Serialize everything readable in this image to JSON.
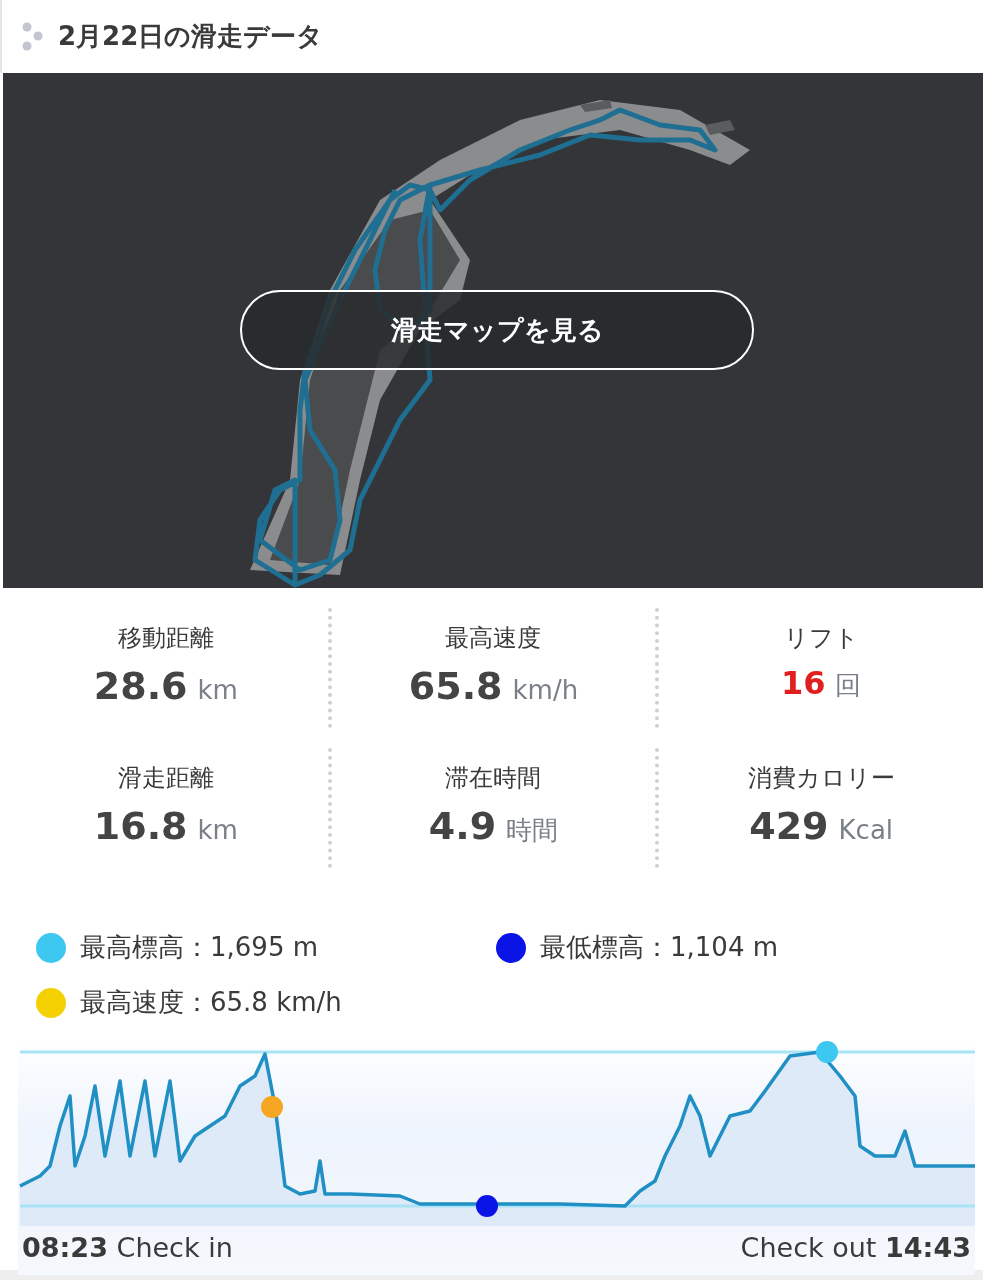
{
  "header": {
    "title": "2月22日の滑走データ"
  },
  "map": {
    "kind": "picture",
    "button": "滑走マップを見る"
  },
  "stats": [
    {
      "label": "移動距離",
      "value": "28.6",
      "unit": "km",
      "emphasis": false
    },
    {
      "label": "最高速度",
      "value": "65.8",
      "unit": "km/h",
      "emphasis": false
    },
    {
      "label": "リフト",
      "value": "16",
      "unit": "回",
      "emphasis": true
    },
    {
      "label": "滑走距離",
      "value": "16.8",
      "unit": "km",
      "emphasis": false
    },
    {
      "label": "滞在時間",
      "value": "4.9",
      "unit": "時間",
      "emphasis": false
    },
    {
      "label": "消費カロリー",
      "value": "429",
      "unit": "Kcal",
      "emphasis": false
    }
  ],
  "legend": [
    {
      "text": "最高標高：1,695 m",
      "color": "#3cc8f0"
    },
    {
      "text": "最低標高：1,104 m",
      "color": "#0a14e6"
    },
    {
      "text": "最高速度：65.8 km/h",
      "color": "#f5d000"
    }
  ],
  "footer": {
    "check_in": "**08:23** Check in",
    "check_out": "Check out **14:43**"
  }
}
